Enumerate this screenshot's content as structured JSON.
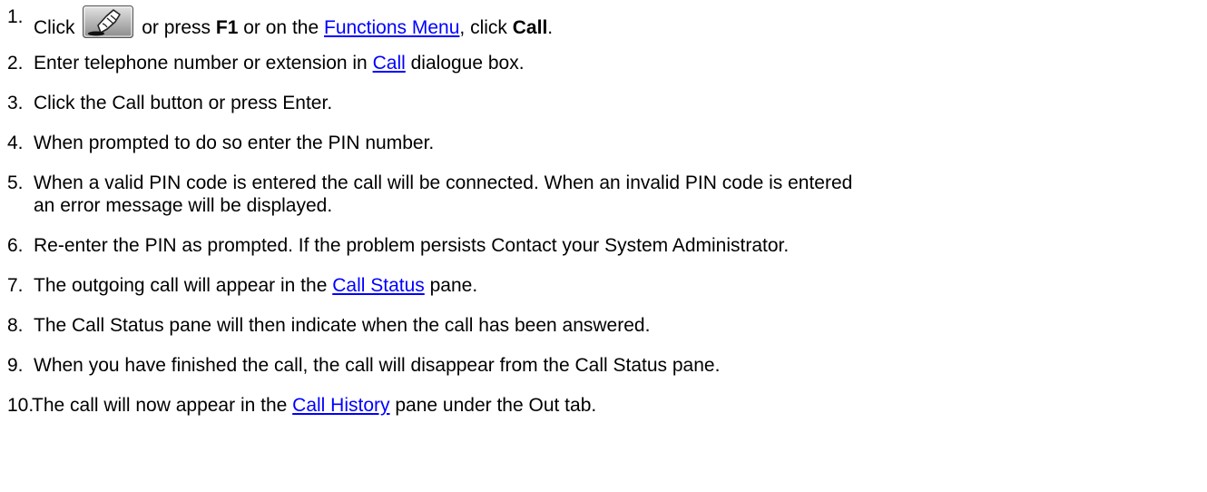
{
  "steps": [
    {
      "number": "1.",
      "before_icon": "Click",
      "icon": "call-button-icon",
      "after_icon_1": "or press",
      "key": "F1",
      "after_key": "or on the",
      "link": "Functions Menu",
      "after_link": ", click",
      "command": "Call",
      "end": "."
    },
    {
      "number": "2.",
      "before_link": "Enter telephone number or extension in",
      "link": "Call",
      "after_link": "dialogue box."
    },
    {
      "number": "3.",
      "text": "Click the Call button or press Enter."
    },
    {
      "number": "4.",
      "text": "When prompted to do so enter the PIN number."
    },
    {
      "number": "5.",
      "line1": "When a valid PIN code is entered the call will be connected. When an invalid PIN code is entered",
      "line2": "an error message will be displayed."
    },
    {
      "number": "6.",
      "text": "Re-enter the PIN as prompted. If the problem persists Contact your System Administrator."
    },
    {
      "number": "7.",
      "before_link": "The outgoing call will appear in the",
      "link": "Call Status",
      "after_link": "pane."
    },
    {
      "number": "8.",
      "text": "The Call Status pane will then indicate when the call has been answered."
    },
    {
      "number": "9.",
      "text": "When you have finished the call, the call will disappear from the Call Status pane."
    },
    {
      "number": "10.",
      "before_link": "The call will now appear in the",
      "link": "Call History",
      "after_link": "pane under the Out tab."
    }
  ]
}
